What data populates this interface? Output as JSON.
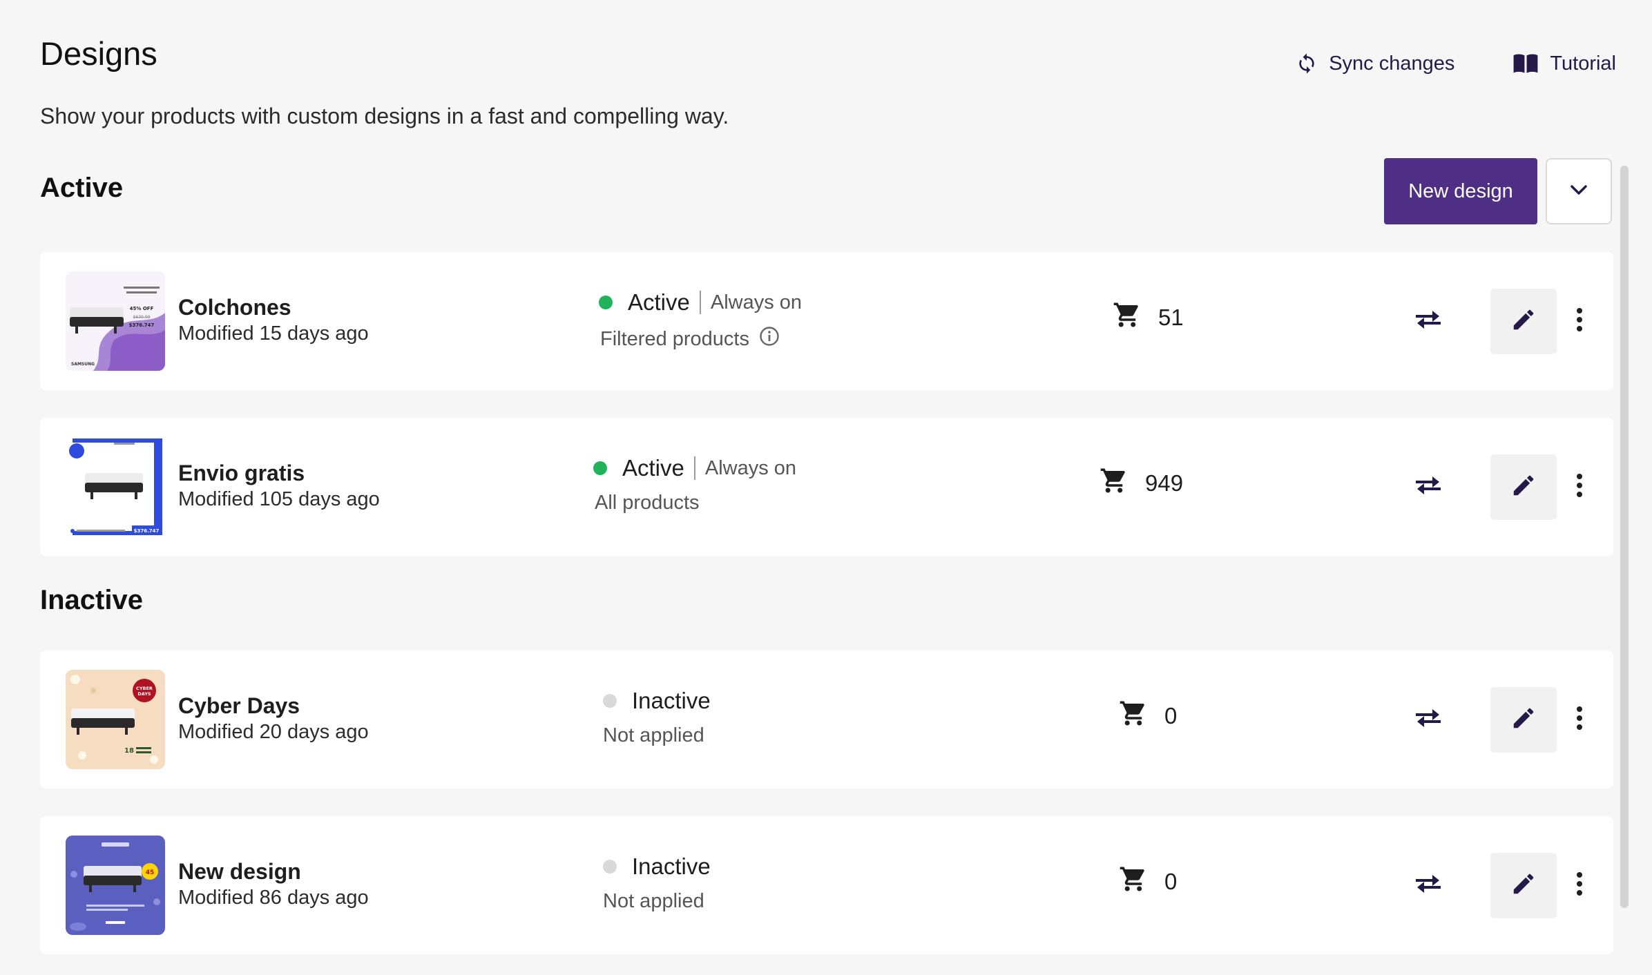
{
  "header": {
    "title": "Designs",
    "subtitle": "Show your products with custom designs in a fast and compelling way.",
    "sync_label": "Sync changes",
    "tutorial_label": "Tutorial"
  },
  "active_section": {
    "title": "Active",
    "new_design_label": "New design",
    "designs": [
      {
        "name": "Colchones",
        "modified": "Modified 15 days ago",
        "status": "Active",
        "schedule": "Always on",
        "scope": "Filtered products",
        "count": "51",
        "status_color": "#21b35a"
      },
      {
        "name": "Envio gratis",
        "modified": "Modified 105 days ago",
        "status": "Active",
        "schedule": "Always on",
        "scope": "All products",
        "count": "949",
        "status_color": "#21b35a"
      }
    ]
  },
  "inactive_section": {
    "title": "Inactive",
    "designs": [
      {
        "name": "Cyber Days",
        "modified": "Modified 20 days ago",
        "status": "Inactive",
        "scope": "Not applied",
        "count": "0",
        "status_color": "#d9d9d9"
      },
      {
        "name": "New design",
        "modified": "Modified 86 days ago",
        "status": "Inactive",
        "scope": "Not applied",
        "count": "0",
        "status_color": "#d9d9d9"
      }
    ]
  },
  "thumbnails": {
    "colchones": {
      "off_text": "45% OFF",
      "old_price": "$639.99",
      "price": "$376.747",
      "brand": "SAMSUNG"
    },
    "envio": {
      "price": "$376.747"
    },
    "cyber": {
      "badge_line1": "CYBER",
      "badge_line2": "DAYS",
      "number": "18"
    },
    "new_design": {
      "badge": "45"
    }
  },
  "colors": {
    "primary": "#4f2f86",
    "icon": "#231a4a",
    "active_dot": "#21b35a",
    "inactive_dot": "#d9d9d9"
  },
  "icons": [
    "sync-icon",
    "book-icon",
    "chevron-down-icon",
    "cart-icon",
    "info-icon",
    "swap-icon",
    "pencil-icon",
    "more-vertical-icon"
  ]
}
